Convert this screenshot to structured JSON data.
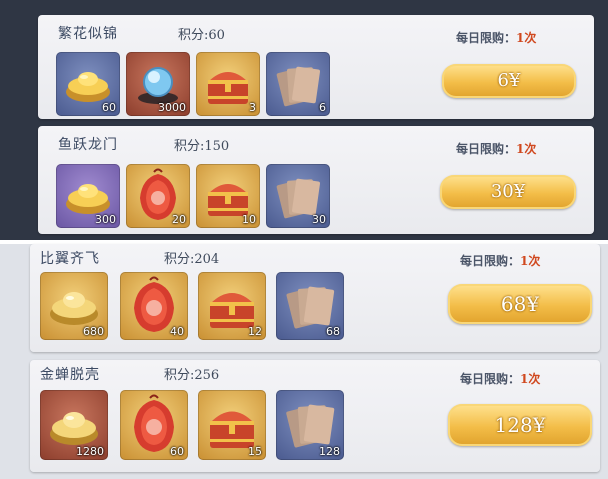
{
  "limit_label": "每日限购：",
  "colors": {
    "limit_count": "#d0481f",
    "button_gold": "#f3bd48"
  },
  "packs": [
    {
      "name": "繁花似锦",
      "score": "积分:60",
      "limit_count": "1次",
      "price": "6¥",
      "items": [
        {
          "icon": "gold-ingot-icon",
          "bg": "blue",
          "qty": "60"
        },
        {
          "icon": "crystal-orb-icon",
          "bg": "red",
          "qty": "3000"
        },
        {
          "icon": "treasure-chest-icon",
          "bg": "gold",
          "qty": "3"
        },
        {
          "icon": "scroll-cards-icon",
          "bg": "blue",
          "qty": "6"
        }
      ]
    },
    {
      "name": "鱼跃龙门",
      "score": "积分:150",
      "limit_count": "1次",
      "price": "30¥",
      "items": [
        {
          "icon": "gold-ingot-icon",
          "bg": "purple",
          "qty": "300"
        },
        {
          "icon": "red-pouch-icon",
          "bg": "gold",
          "qty": "20"
        },
        {
          "icon": "treasure-chest-icon",
          "bg": "gold",
          "qty": "10"
        },
        {
          "icon": "scroll-cards-icon",
          "bg": "blue",
          "qty": "30"
        }
      ]
    },
    {
      "name": "比翼齐飞",
      "score": "积分:204",
      "limit_count": "1次",
      "price": "68¥",
      "items": [
        {
          "icon": "gold-ingot-icon",
          "bg": "gold",
          "qty": "680"
        },
        {
          "icon": "red-pouch-icon",
          "bg": "gold",
          "qty": "40"
        },
        {
          "icon": "treasure-chest-icon",
          "bg": "gold",
          "qty": "12"
        },
        {
          "icon": "scroll-cards-icon",
          "bg": "blue",
          "qty": "68"
        }
      ]
    },
    {
      "name": "金蝉脱壳",
      "score": "积分:256",
      "limit_count": "1次",
      "price": "128¥",
      "items": [
        {
          "icon": "gold-ingot-icon",
          "bg": "red",
          "qty": "1280"
        },
        {
          "icon": "red-pouch-icon",
          "bg": "gold",
          "qty": "60"
        },
        {
          "icon": "treasure-chest-icon",
          "bg": "gold",
          "qty": "15"
        },
        {
          "icon": "scroll-cards-icon",
          "bg": "blue",
          "qty": "128"
        }
      ]
    }
  ]
}
